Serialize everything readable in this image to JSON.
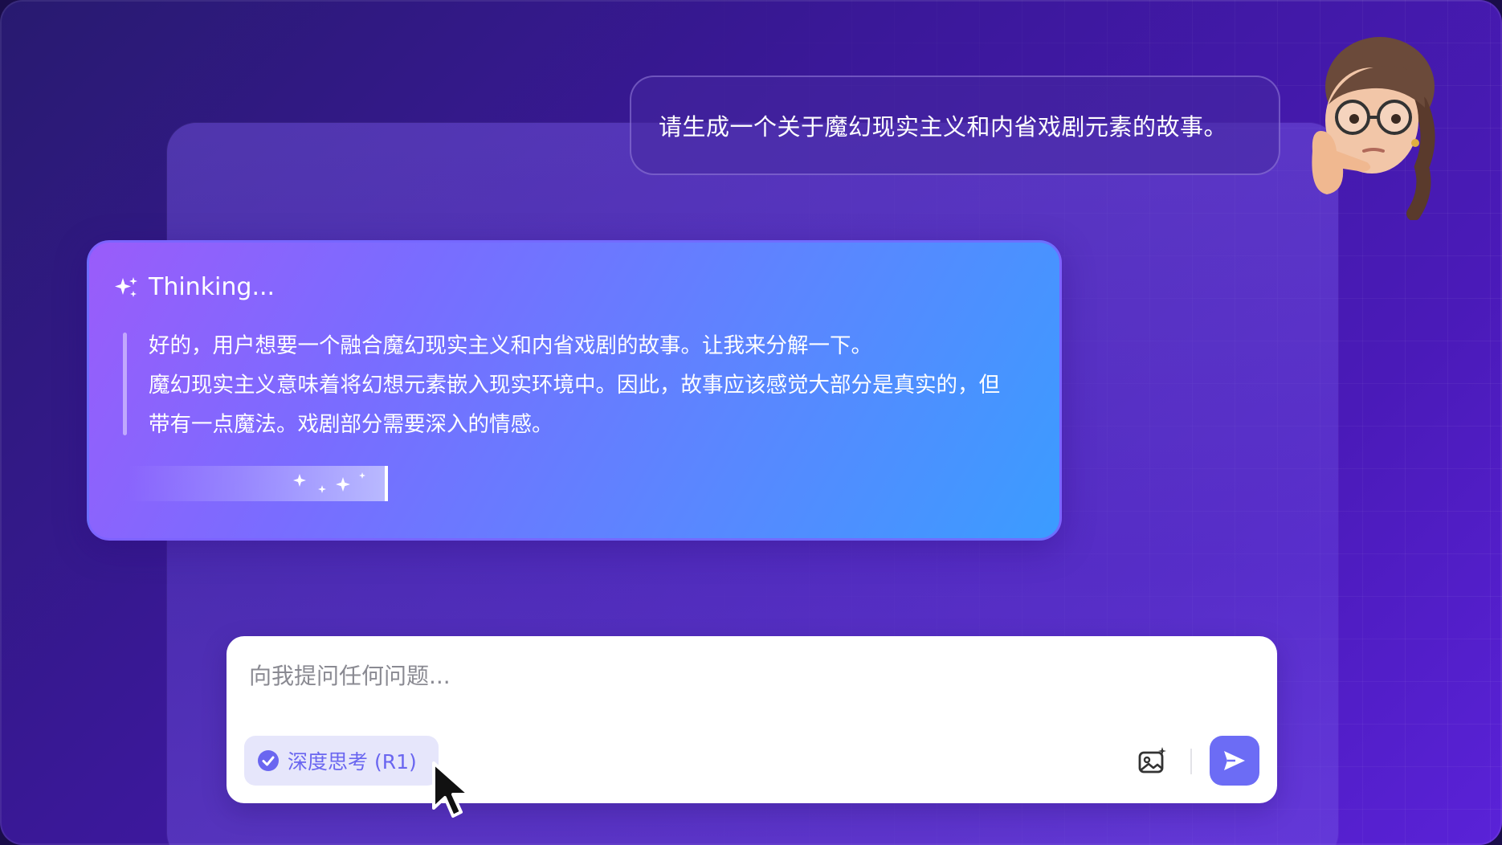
{
  "conversation": {
    "user_message": "请生成一个关于魔幻现实主义和内省戏剧元素的故事。"
  },
  "thinking": {
    "title": "Thinking...",
    "lines": [
      "好的，用户想要一个融合魔幻现实主义和内省戏剧的故事。让我来分解一下。",
      "魔幻现实主义意味着将幻想元素嵌入现实环境中。因此，故事应该感觉大部分是真实的，但带有一点魔法。戏剧部分需要深入的情感。"
    ],
    "icon": "sparkles-icon"
  },
  "composer": {
    "placeholder": "向我提问任何问题...",
    "value": "",
    "deep_think_label": "深度思考 (R1)",
    "deep_think_enabled": true,
    "image_button_icon": "image-sparkle-icon",
    "send_button_icon": "send-icon"
  },
  "colors": {
    "background_start": "#281a70",
    "background_end": "#5a22d8",
    "thinking_card_start": "#9a5cfa",
    "thinking_card_end": "#3b9cff",
    "accent": "#6c6cf5",
    "chip_bg": "#e6e6fb"
  }
}
